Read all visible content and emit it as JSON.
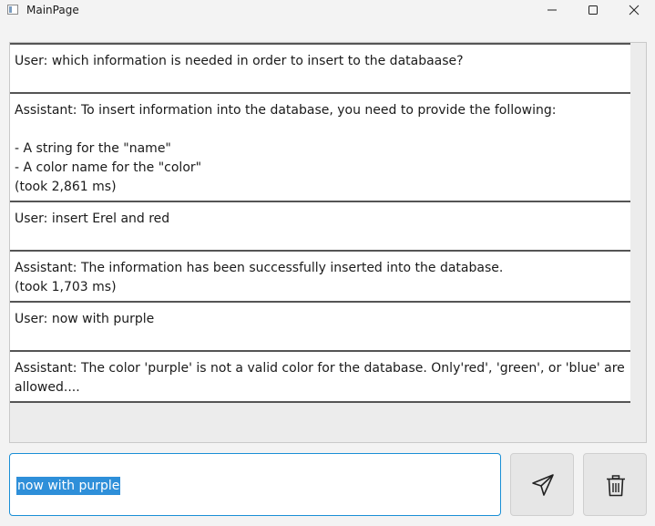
{
  "window": {
    "title": "MainPage"
  },
  "messages": [
    {
      "text": "User: which information is needed in order to insert to the databaase?"
    },
    {
      "text": "Assistant: To insert information into the database, you need to provide the following:\n\n- A string for the \"name\"\n- A color name for the \"color\"\n(took 2,861 ms)"
    },
    {
      "text": "User: insert Erel and red"
    },
    {
      "text": "Assistant: The information has been successfully inserted into the database.\n(took 1,703 ms)"
    },
    {
      "text": "User: now with purple"
    },
    {
      "text": "Assistant: The color 'purple' is not a valid color for the database. Only'red', 'green', or 'blue' are\nallowed...."
    }
  ],
  "input": {
    "value": "now with purple"
  },
  "buttons": {
    "send_icon": "paper-plane-icon",
    "clear_icon": "trash-icon"
  },
  "colors": {
    "accent": "#1a8fd6",
    "selection": "#2e8fd9",
    "message_border": "#555555"
  }
}
